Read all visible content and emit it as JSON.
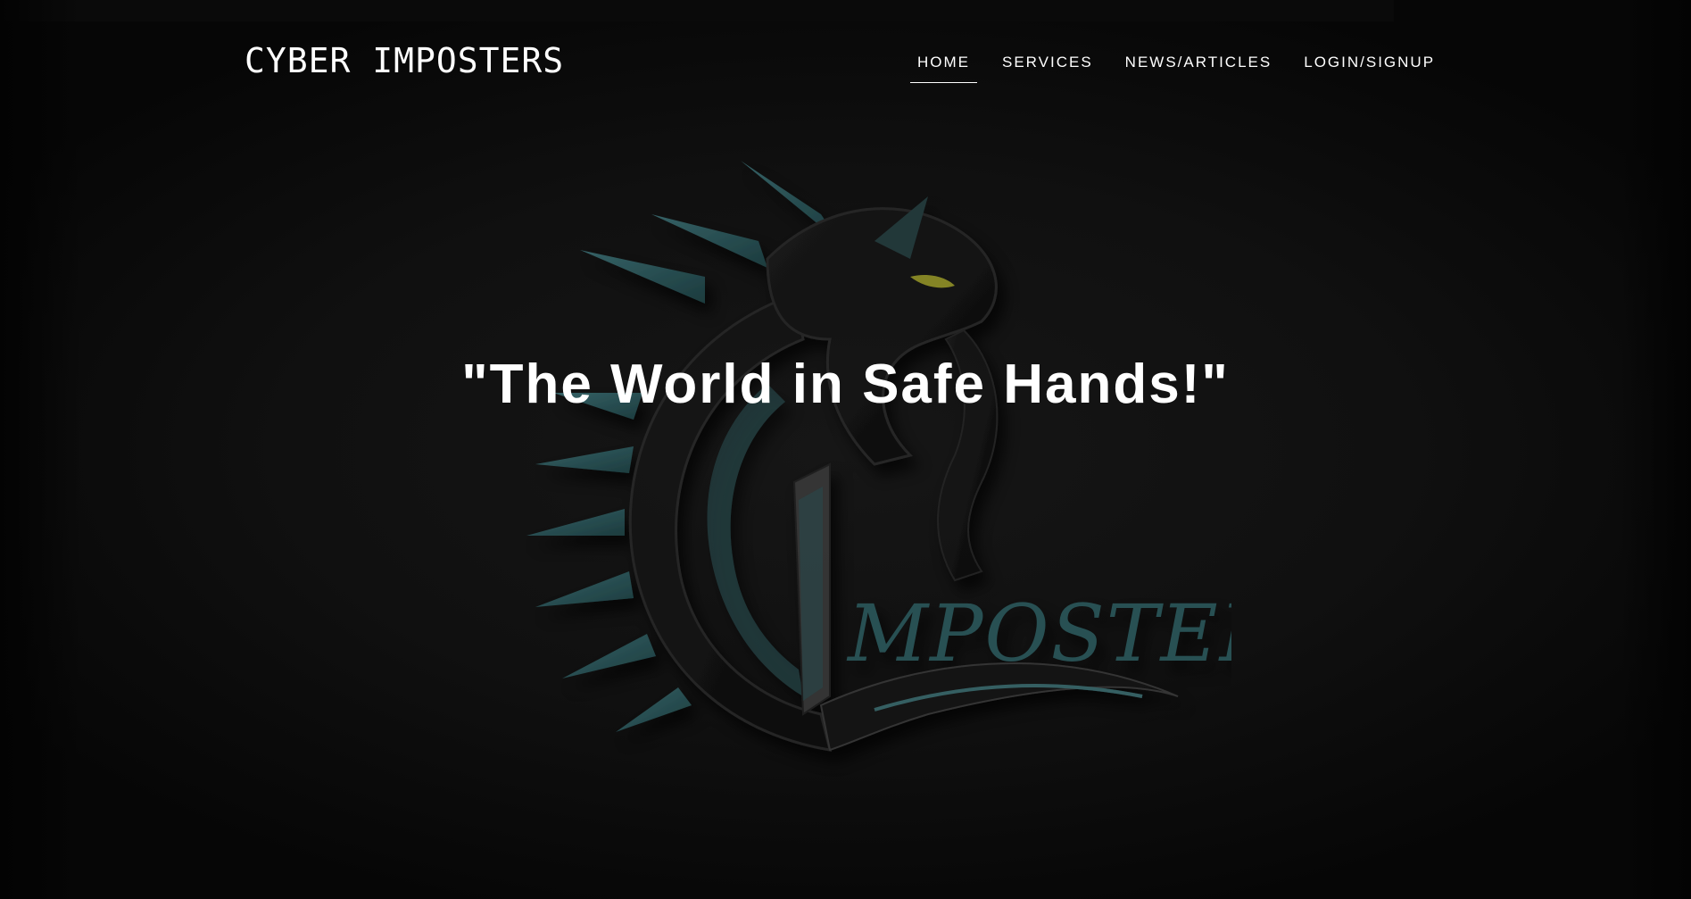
{
  "header": {
    "brand": "CYBER IMPOSTERS",
    "nav": [
      {
        "label": "HOME",
        "active": true
      },
      {
        "label": "SERVICES",
        "active": false
      },
      {
        "label": "NEWS/ARTICLES",
        "active": false
      },
      {
        "label": "LOGIN/SIGNUP",
        "active": false
      }
    ]
  },
  "hero": {
    "title": "\"The World in Safe Hands!\"",
    "emblem_icon": "dragon-emblem-icon",
    "emblem_wordmark": "MPOSTERS"
  },
  "colors": {
    "background": "#0d0d0d",
    "text": "#ffffff",
    "emblem_teal": "#2c5a5e",
    "emblem_eye": "#9a9a2a"
  }
}
